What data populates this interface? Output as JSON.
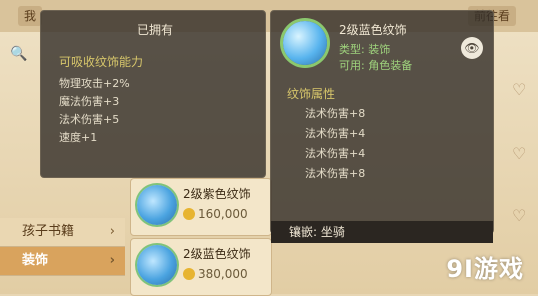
{
  "tabs": [
    "我",
    "前往看"
  ],
  "left_categories": [
    {
      "label": "孩子书籍",
      "selected": false
    },
    {
      "label": "装饰",
      "selected": true
    }
  ],
  "items": [
    {
      "name": "2级紫色纹饰",
      "price": "160,000"
    },
    {
      "name": "2级蓝色纹饰",
      "price": "380,000"
    }
  ],
  "tooltip_left": {
    "title": "已拥有",
    "section": "可吸收纹饰能力",
    "lines": [
      "物理攻击+2%",
      "魔法伤害+3",
      "法术伤害+5",
      "速度+1"
    ]
  },
  "tooltip_right": {
    "title": "2级蓝色纹饰",
    "tag1": "类型: 装饰",
    "tag2": "可用: 角色装备",
    "section": "纹饰属性",
    "lines": [
      "法术伤害+8",
      "法术伤害+4",
      "法术伤害+4",
      "法术伤害+8"
    ],
    "bar_text": "镶嵌: 坐骑"
  },
  "watermark": "9I游戏",
  "icons": {
    "search": "search-icon",
    "eye": "eye-icon",
    "heart": "heart-icon",
    "arrow": "chevron-right-icon",
    "coin": "coin-icon"
  }
}
